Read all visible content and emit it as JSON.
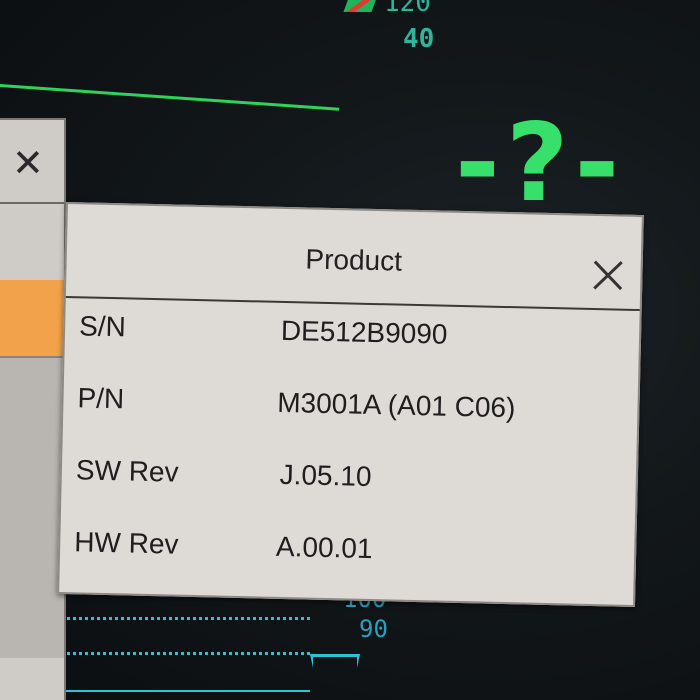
{
  "background": {
    "top_numbers": [
      "120",
      "40"
    ],
    "big_status": "-?-",
    "bottom_numbers": [
      "100",
      "90"
    ],
    "colors": {
      "wave_green": "#2fd35a",
      "teal": "#2fb59c",
      "cyan": "#2ec2d6",
      "status_green": "#36e06a"
    }
  },
  "left_window": {
    "close_icon": "close-icon",
    "highlight_color": "#f2a24a"
  },
  "dialog": {
    "title": "Product",
    "close_icon": "close-icon",
    "rows": [
      {
        "label": "S/N",
        "value": "DE512B9090"
      },
      {
        "label": "P/N",
        "value": "M3001A (A01 C06)"
      },
      {
        "label": "SW Rev",
        "value": "J.05.10"
      },
      {
        "label": "HW Rev",
        "value": "A.00.01"
      }
    ]
  }
}
